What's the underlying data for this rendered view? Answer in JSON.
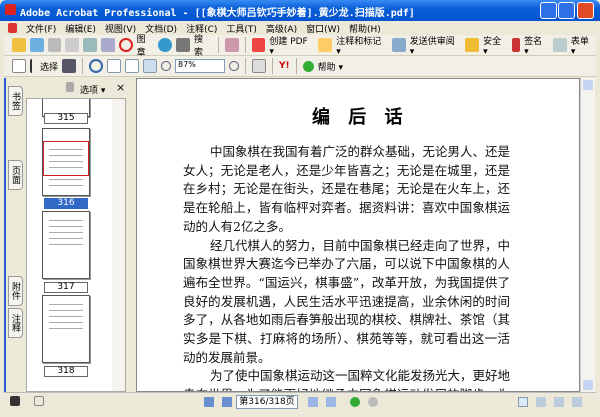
{
  "window": {
    "title": "Adobe Acrobat Professional - [[象棋大师吕钦巧手妙着].黄少龙.扫描版.pdf]"
  },
  "menu": [
    "文件(F)",
    "编辑(E)",
    "视图(V)",
    "文档(D)",
    "注释(C)",
    "工具(T)",
    "高级(A)",
    "窗口(W)",
    "帮助(H)"
  ],
  "toolbar1": {
    "stamp": "图章",
    "search": "搜索",
    "create_pdf": "创建 PDF ▾",
    "comment": "注释和标记 ▾",
    "review": "发送供审阅 ▾",
    "security": "安全 ▾",
    "sign": "签名 ▾",
    "forms": "表单 ▾"
  },
  "toolbar2": {
    "select": "选择",
    "zoom": "87%",
    "help": "帮助 ▾"
  },
  "sidebar": {
    "options": "选项 ▾",
    "close": "×",
    "tabs": [
      "书签",
      "页面",
      "附件",
      "注释"
    ],
    "pages": [
      "315",
      "316",
      "317",
      "318"
    ],
    "selected": "316"
  },
  "document": {
    "heading": "编 后 话",
    "lines": [
      {
        "t": "中国象棋在我国有着广泛的群众基础，无论男人、还是",
        "ind": true
      },
      {
        "t": "女人；无论是老人，还是少年皆喜之；无论是在城里，还是"
      },
      {
        "t": "在乡村；无论是在街头，还是在巷尾；无论是在火车上，还"
      },
      {
        "t": "是在轮船上，皆有临枰对弈者。据资料讲：喜欢中国象棋运"
      },
      {
        "t": "动的人有2亿之多。",
        "nojust": true
      },
      {
        "t": "经几代棋人的努力，目前中国象棋已经走向了世界，中",
        "ind": true
      },
      {
        "t": "国象棋世界大赛迄今已举办了六届，可以说下中国象棋的人"
      },
      {
        "t": "遍布全世界。“国运兴，棋事盛”，改革开放，为我国提供了"
      },
      {
        "t": "良好的发展机遇，人民生活水平迅速提高，业余休闲的时间"
      },
      {
        "t": "多了，从各地如雨后春笋般出现的棋校、棋牌社、茶馆（其"
      },
      {
        "t": "实多是下棋、打麻将的场所）、棋苑等等，就可看出这一活"
      },
      {
        "t": "动的发展前景。",
        "nojust": true
      },
      {
        "t": "为了使中国象棋运动这一国粹文化能发扬光大，更好地",
        "ind": true
      },
      {
        "t": "走向世界，为了能更好地继承中国象棋运动发展的脚步，为"
      }
    ]
  },
  "status": {
    "page": "第316/318页"
  }
}
